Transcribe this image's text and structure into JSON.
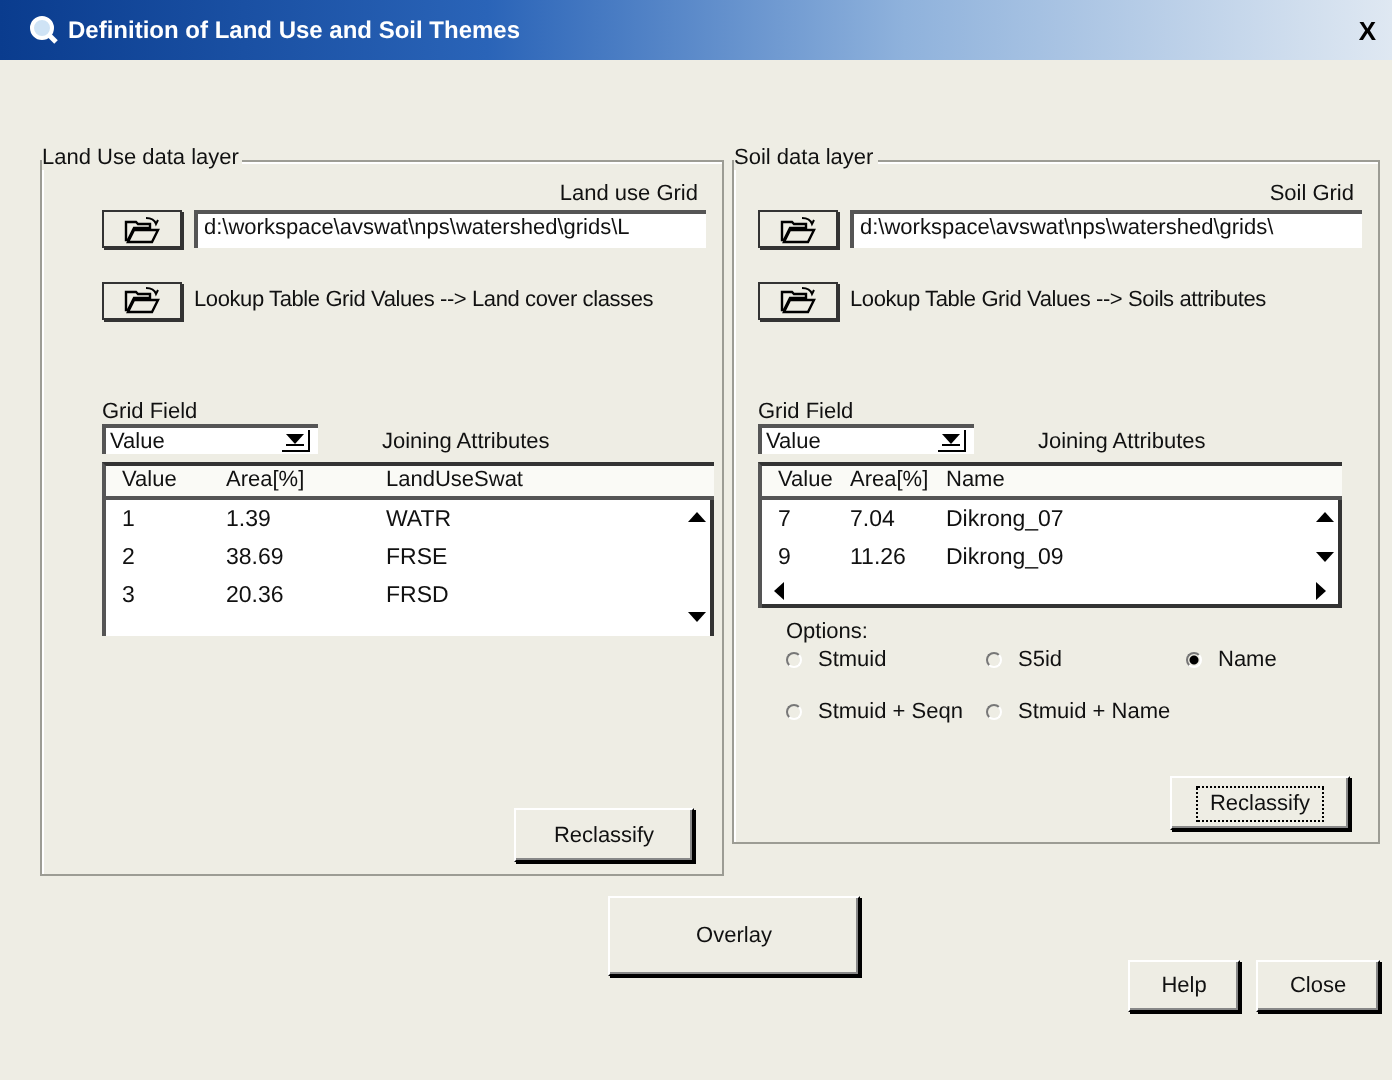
{
  "window": {
    "title": "Definition of Land Use and Soil Themes",
    "close": "X"
  },
  "panels": [
    {
      "title": "Land Use data layer",
      "grid_label": "Land use Grid",
      "grid_path": "d:\\workspace\\avswat\\nps\\watershed\\grids\\L",
      "lookup_label": "Lookup Table  Grid Values --> Land cover classes",
      "grid_field_label": "Grid Field",
      "grid_field_value": "Value",
      "joining_label": "Joining Attributes",
      "columns": [
        "Value",
        "Area[%]",
        "LandUseSwat"
      ],
      "rows": [
        [
          "1",
          "1.39",
          "WATR"
        ],
        [
          "2",
          "38.69",
          "FRSE"
        ],
        [
          "3",
          "20.36",
          "FRSD"
        ]
      ],
      "reclassify": {
        "label": "Reclassify",
        "focused": false
      }
    },
    {
      "title": "Soil data layer",
      "grid_label": "Soil Grid",
      "grid_path": "d:\\workspace\\avswat\\nps\\watershed\\grids\\",
      "lookup_label": "Lookup Table  Grid Values --> Soils attributes",
      "grid_field_label": "Grid Field",
      "grid_field_value": "Value",
      "joining_label": "Joining Attributes",
      "columns": [
        "Value",
        "Area[%]",
        "Name"
      ],
      "rows": [
        [
          "7",
          "7.04",
          "Dikrong_07"
        ],
        [
          "9",
          "11.26",
          "Dikrong_09"
        ]
      ],
      "horizontal_scrollbar": true,
      "options": {
        "label": "Options:",
        "items": [
          {
            "label": "Stmuid",
            "selected": false
          },
          {
            "label": "S5id",
            "selected": false
          },
          {
            "label": "Name",
            "selected": true
          },
          {
            "label": "Stmuid + Seqn",
            "selected": false
          },
          {
            "label": "Stmuid + Name",
            "selected": false
          }
        ]
      },
      "reclassify": {
        "label": "Reclassify",
        "focused": true
      }
    }
  ],
  "overlay_button": "Overlay",
  "buttons": [
    "Help",
    "Close"
  ]
}
